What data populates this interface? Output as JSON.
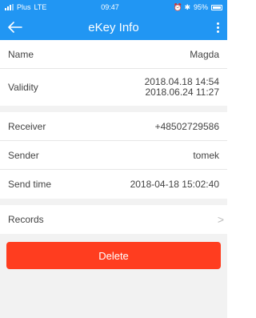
{
  "status_bar": {
    "carrier": "Plus",
    "network": "LTE",
    "time": "09:47",
    "icons": "⏰ ✱",
    "battery": "95%"
  },
  "header": {
    "title": "eKey Info",
    "back_icon": "arrow-left-icon",
    "menu_icon": "more-vertical-icon"
  },
  "details": {
    "name_label": "Name",
    "name_value": "Magda",
    "validity_label": "Validity",
    "validity_start": "2018.04.18 14:54",
    "validity_end": "2018.06.24 11:27"
  },
  "transfer": {
    "receiver_label": "Receiver",
    "receiver_value": "+48502729586",
    "sender_label": "Sender",
    "sender_value": "tomek",
    "send_time_label": "Send time",
    "send_time_value": "2018-04-18 15:02:40"
  },
  "records": {
    "label": "Records",
    "chevron": ">"
  },
  "actions": {
    "delete_label": "Delete"
  },
  "colors": {
    "header_blue": "#2196f3",
    "delete_red": "#ff3d1f",
    "background": "#f2f2f2"
  }
}
